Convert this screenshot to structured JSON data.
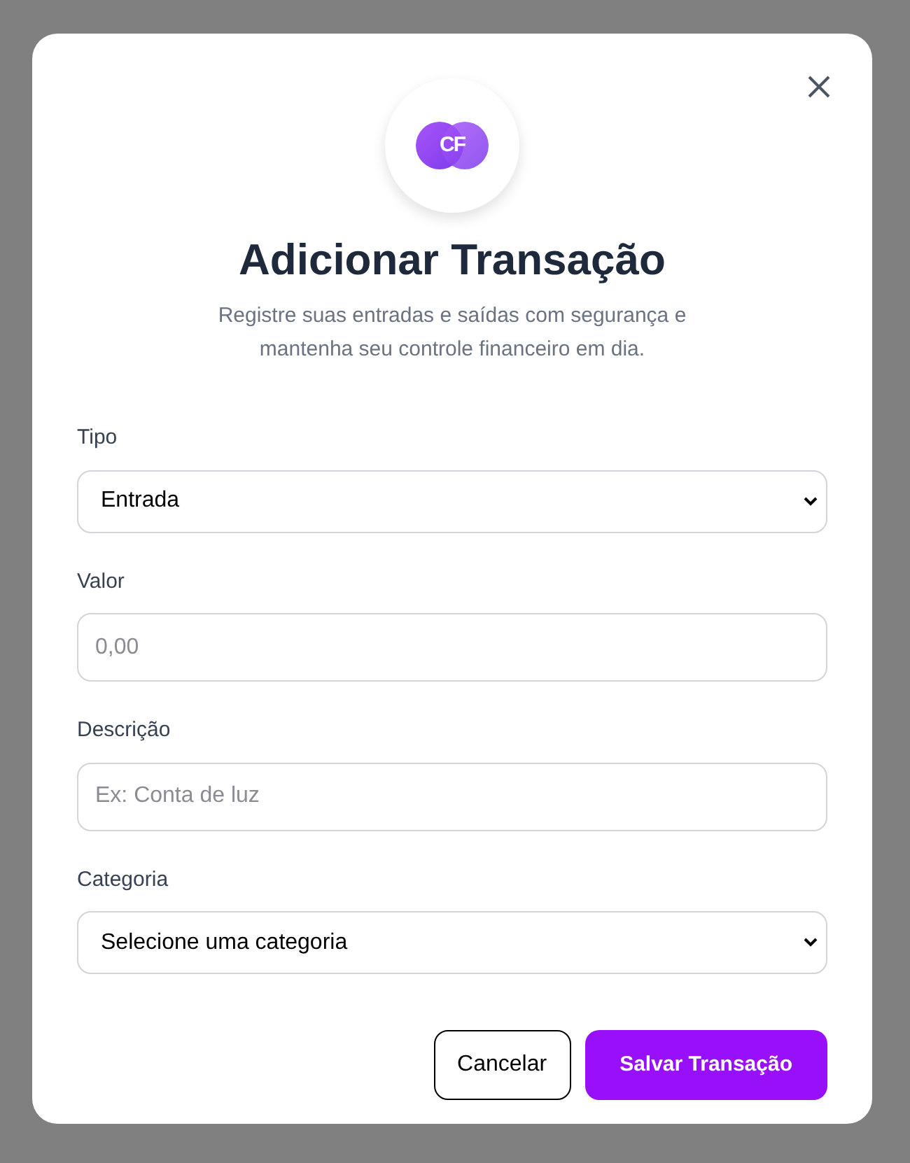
{
  "logo": {
    "text": "CF"
  },
  "title": "Adicionar Transação",
  "subtitle": "Registre suas entradas e saídas com segurança e mantenha seu controle financeiro em dia.",
  "fields": [
    {
      "kind": "select",
      "label": "Tipo",
      "value": "Entrada"
    },
    {
      "kind": "input",
      "label": "Valor",
      "placeholder": "0,00"
    },
    {
      "kind": "input",
      "label": "Descrição",
      "placeholder": "Ex: Conta de luz"
    },
    {
      "kind": "select",
      "label": "Categoria",
      "value": "Selecione uma categoria"
    }
  ],
  "buttons": [
    {
      "kind": "secondary",
      "label": "Cancelar"
    },
    {
      "kind": "primary",
      "label": "Salvar Transação"
    }
  ]
}
